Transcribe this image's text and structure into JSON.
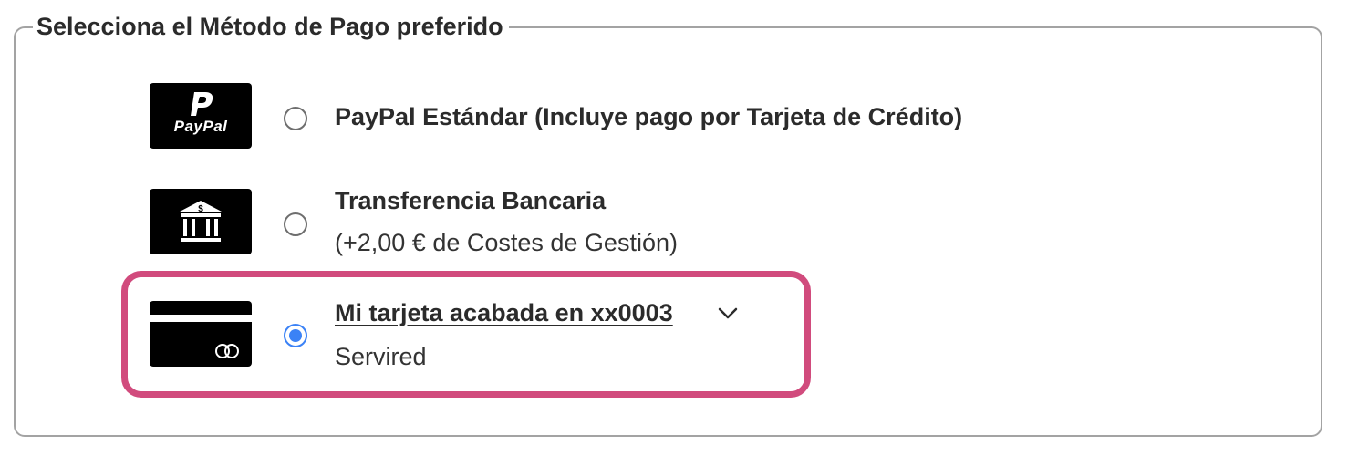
{
  "section": {
    "legend": "Selecciona el Método de Pago preferido"
  },
  "methods": [
    {
      "icon": "paypal-logo-icon",
      "title": "PayPal Estándar (Incluye pago por Tarjeta de Crédito)",
      "subtitle": "",
      "selected": false,
      "logo_text": "PayPal"
    },
    {
      "icon": "bank-icon",
      "title": "Transferencia Bancaria",
      "subtitle": "(+2,00 € de Costes de Gestión)",
      "selected": false
    },
    {
      "icon": "credit-card-icon",
      "title": "Mi tarjeta acabada en xx0003",
      "subtitle": "Servired",
      "selected": true
    }
  ],
  "colors": {
    "highlight": "#d14b7d",
    "radio_selected": "#3b82f6",
    "icon_background": "#000000"
  }
}
